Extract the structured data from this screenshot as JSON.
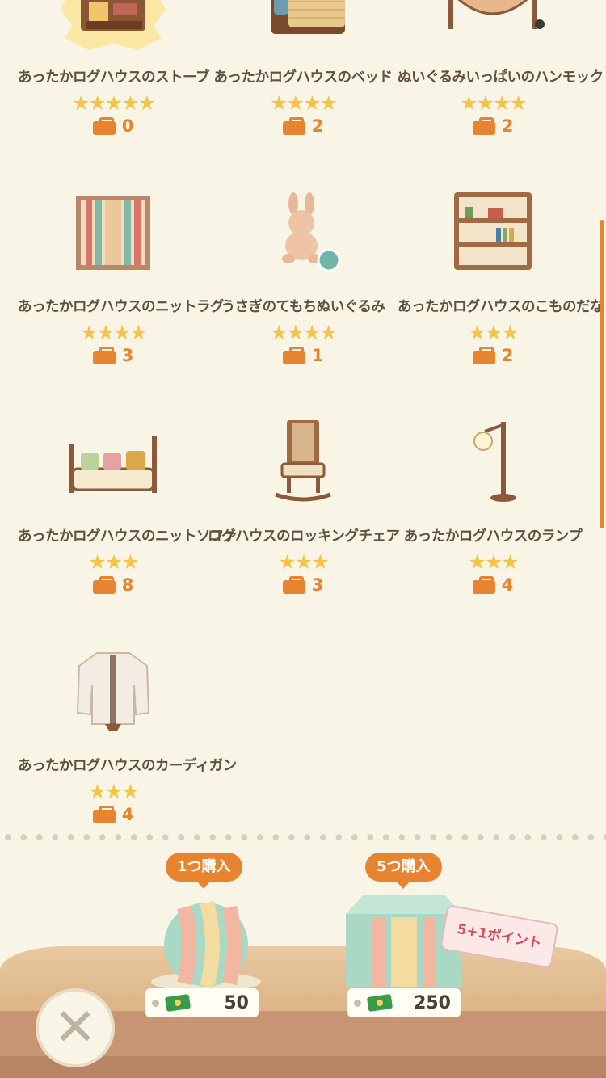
{
  "items": [
    {
      "name": "あったかログハウスのストーブ",
      "stars": "★★★★★",
      "owned": "0"
    },
    {
      "name": "あったかログハウスのベッド",
      "stars": "★★★★",
      "owned": "2"
    },
    {
      "name": "ぬいぐるみいっぱいのハンモック",
      "stars": "★★★★",
      "owned": "2"
    },
    {
      "name": "あったかログハウスのニットラグ",
      "stars": "★★★★",
      "owned": "3"
    },
    {
      "name": "うさぎのてもちぬいぐるみ",
      "stars": "★★★★",
      "owned": "1"
    },
    {
      "name": "あったかログハウスのこものだな",
      "stars": "★★★",
      "owned": "2"
    },
    {
      "name": "あったかログハウスのニットソファ",
      "stars": "★★★",
      "owned": "8"
    },
    {
      "name": "ログハウスのロッキングチェア",
      "stars": "★★★",
      "owned": "3"
    },
    {
      "name": "あったかログハウスのランプ",
      "stars": "★★★",
      "owned": "4"
    },
    {
      "name": "あったかログハウスのカーディガン",
      "stars": "★★★",
      "owned": "4"
    }
  ],
  "purchase": {
    "single": {
      "label": "1つ購入",
      "price": "50"
    },
    "five": {
      "label": "5つ購入",
      "price": "250",
      "bonus": "5+1ポイント"
    }
  },
  "close": {
    "label": "✕"
  }
}
